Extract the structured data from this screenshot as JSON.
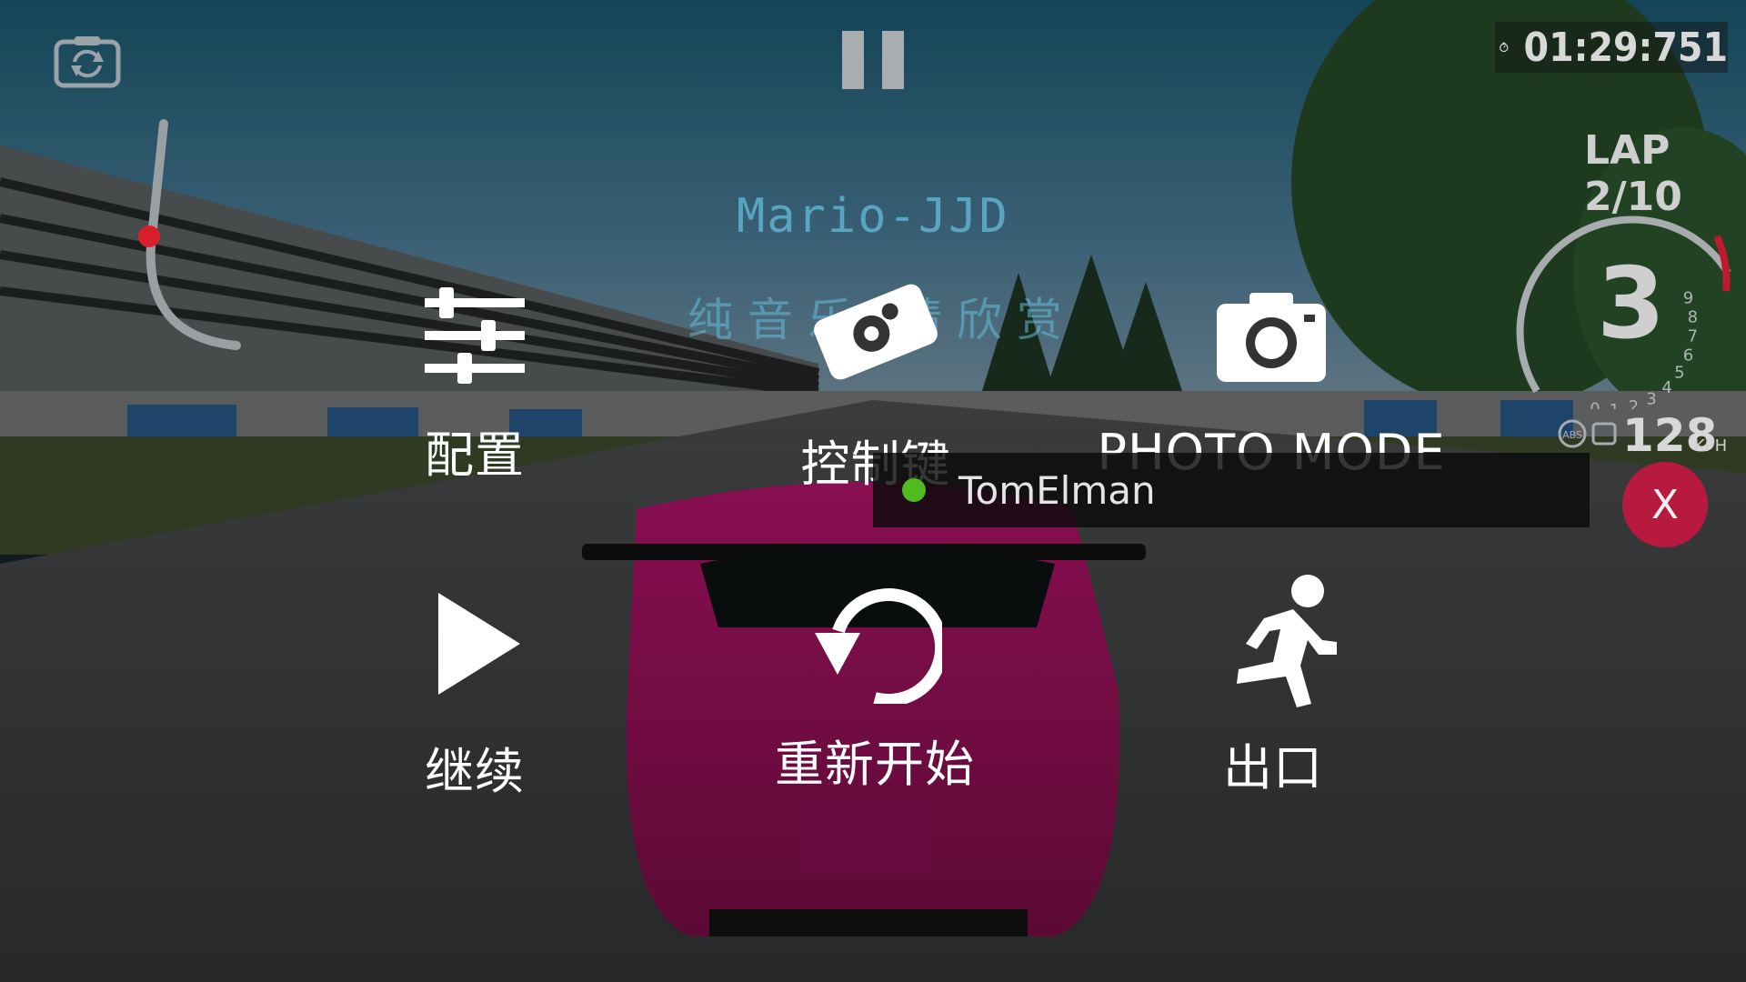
{
  "hud": {
    "lap_time": "01:29:751",
    "lap": "LAP 2/10",
    "gear": "3",
    "speed": "128",
    "speed_unit": "KPH",
    "tach_ticks": [
      "0",
      "1",
      "2",
      "3",
      "4",
      "5",
      "6",
      "7",
      "8",
      "9"
    ]
  },
  "watermark": {
    "line1": "Mario-JJD",
    "line2": "纯音乐·精欣赏"
  },
  "pause_menu": {
    "items": [
      {
        "label": "配置",
        "icon": "sliders-icon"
      },
      {
        "label": "控制键",
        "icon": "phone-gear-icon"
      },
      {
        "label": "PHOTO MODE",
        "icon": "camera-icon"
      },
      {
        "label": "继续",
        "icon": "play-icon"
      },
      {
        "label": "重新开始",
        "icon": "restart-icon"
      },
      {
        "label": "出口",
        "icon": "running-man-icon"
      }
    ]
  },
  "notification": {
    "player_name": "TomElman",
    "status_color": "#4fbb1f"
  },
  "close_button": {
    "label": "X",
    "color": "#b8193f"
  }
}
